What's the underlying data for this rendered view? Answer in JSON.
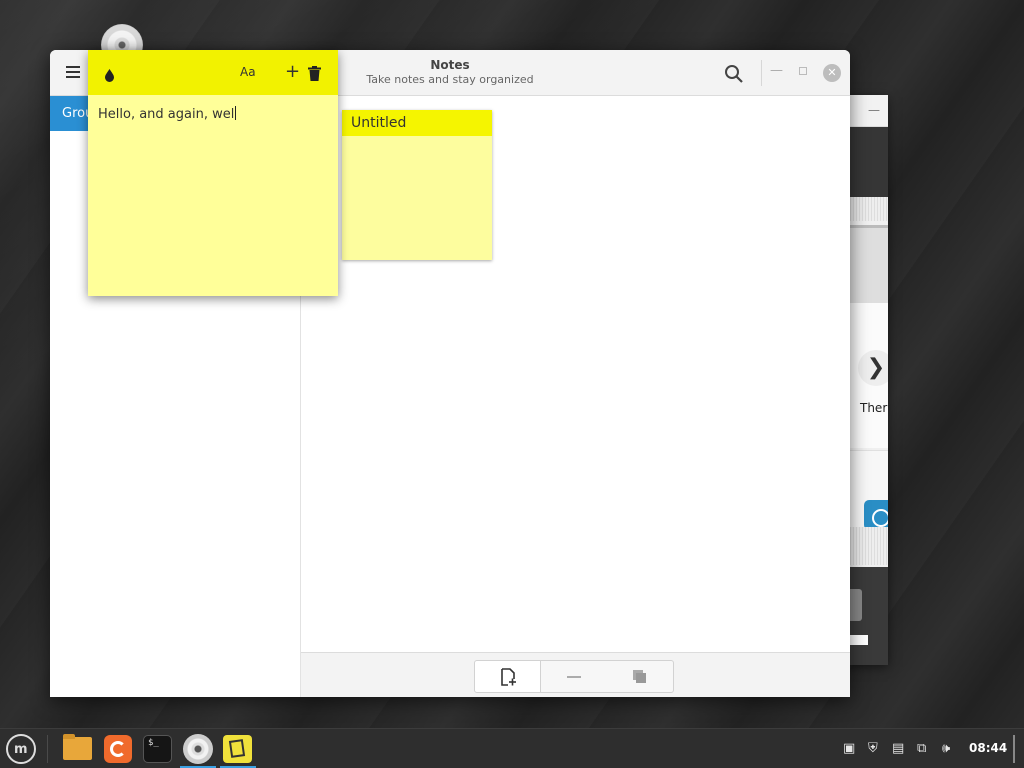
{
  "window": {
    "title": "Notes",
    "subtitle": "Take notes and stay organized"
  },
  "sidebar": {
    "groups_label": "Grou"
  },
  "notes": [
    {
      "title": "Untitled"
    }
  ],
  "sticky_note": {
    "text": "Hello, and again, wel",
    "font_button_label": "Aa",
    "add_label": "+"
  },
  "background_window": {
    "theme_label": "Ther"
  },
  "taskbar": {
    "clock": "08:44"
  },
  "colors": {
    "sticky_header": "#f2f200",
    "sticky_body": "#ffff99",
    "accent": "#2a8fd3"
  },
  "icons": [
    "hamburger-icon",
    "search-icon",
    "minimize-icon",
    "maximize-icon",
    "close-icon",
    "color-drop-icon",
    "font-icon",
    "add-icon",
    "trash-icon",
    "new-note-icon",
    "remove-icon",
    "duplicate-icon"
  ]
}
